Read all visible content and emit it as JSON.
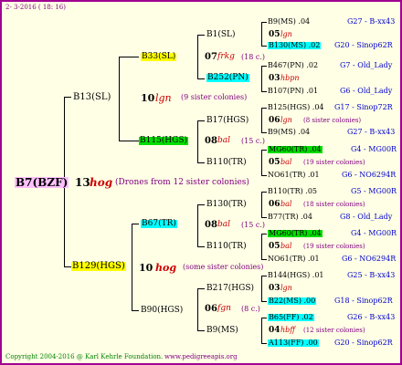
{
  "header": {
    "date": "2-  3-2016 ( 18: 16)"
  },
  "footer": {
    "copyright": "Copyright 2004-2016 @ Karl Kehrle Foundation.",
    "site": "www.pedigreeapis.org"
  },
  "root": {
    "label": "B7(BZF)",
    "gen": "13",
    "breed": "hog",
    "note": "(Drones from 12 sister colonies)"
  },
  "gen1": [
    {
      "label": "B13(SL)",
      "gen": "10",
      "breed": "lgn",
      "note": "(9 sister colonies)"
    },
    {
      "label": "B129(HGS)",
      "gen": "10",
      "breed": "hog",
      "note": "(some sister colonies)"
    }
  ],
  "gen2": [
    {
      "label": "B33(SL)",
      "gen": "07",
      "breed": "frkg",
      "note": "(18 c.)",
      "drone": "B252(PN)"
    },
    {
      "label": "B115(HGS)",
      "gen": "08",
      "breed": "bal",
      "note": "(15 c.)",
      "drone": "B110(TR)"
    },
    {
      "label": "B67(TR)",
      "gen": "08",
      "breed": "bal",
      "note": "(15 c.)",
      "drone": "B110(TR)"
    },
    {
      "label": "B90(HGS)",
      "gen": "06",
      "breed": "fgn",
      "note": "(8 c.)",
      "drone": "B9(MS)"
    }
  ],
  "gen3": [
    {
      "label": "B1(SL)",
      "gen": "05",
      "breed": "lgn",
      "note": ""
    },
    {
      "label": "B252(PN)",
      "gen": "03",
      "breed": "hbpn",
      "note": ""
    },
    {
      "label": "B17(HGS)",
      "gen": "06",
      "breed": "lgn",
      "note": "(8 sister colonies)"
    },
    {
      "label": "B110(TR)",
      "gen": "05",
      "breed": "bal",
      "note": "(19 sister colonies)"
    },
    {
      "label": "B130(TR)",
      "gen": "06",
      "breed": "bal",
      "note": "(18 sister colonies)"
    },
    {
      "label": "B110(TR)",
      "gen": "05",
      "breed": "bal",
      "note": "(19 sister colonies)"
    },
    {
      "label": "B217(HGS)",
      "gen": "03",
      "breed": "lgn",
      "note": ""
    },
    {
      "label": "B9(MS)",
      "gen": "04",
      "breed": "hbff",
      "note": "(12 sister colonies)"
    }
  ],
  "gen4": [
    {
      "left": "B9(MS) .04",
      "right": "G27 - B-xx43"
    },
    {
      "left": "B130(MS) .02",
      "right": "G20 - Sinop62R"
    },
    {
      "left": "B467(PN) .02",
      "right": "G7 - Old_Lady"
    },
    {
      "left": "B107(PN) .01",
      "right": "G6 - Old_Lady"
    },
    {
      "left": "B125(HGS) .04",
      "right": "G17 - Sinop72R"
    },
    {
      "left": "B9(MS) .04",
      "right": "G27 - B-xx43"
    },
    {
      "left": "MG60(TR) .04",
      "right": "G4 - MG00R"
    },
    {
      "left": "NO61(TR) .01",
      "right": "G6 - NO6294R"
    },
    {
      "left": "B110(TR) .05",
      "right": "G5 - MG00R"
    },
    {
      "left": "B77(TR) .04",
      "right": "G8 - Old_Lady"
    },
    {
      "left": "MG60(TR) .04",
      "right": "G4 - MG00R"
    },
    {
      "left": "NO61(TR) .01",
      "right": "G6 - NO6294R"
    },
    {
      "left": "B144(HGS) .01",
      "right": "G25 - B-xx43"
    },
    {
      "left": "B22(MS) .00",
      "right": "G18 - Sinop62R"
    },
    {
      "left": "B65(FF) .02",
      "right": "G26 - B-xx43"
    },
    {
      "left": "A113(FF) .00",
      "right": "G20 - Sinop62R"
    }
  ]
}
